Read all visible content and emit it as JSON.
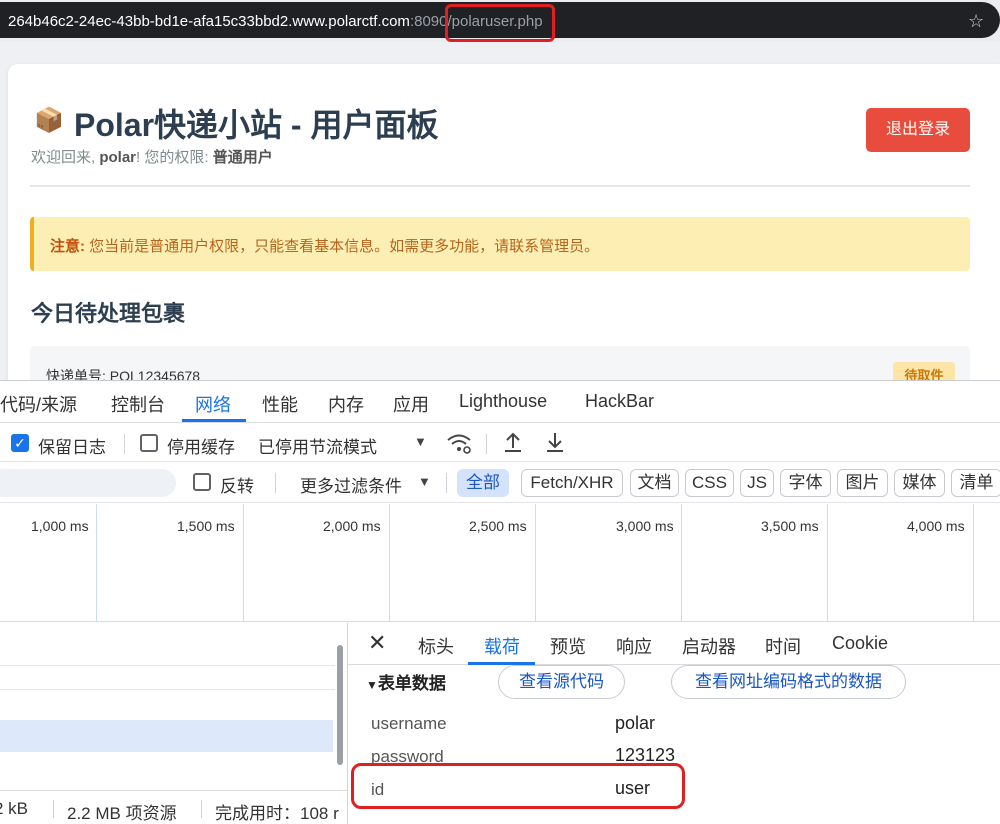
{
  "browser": {
    "url_host": "264b46c2-24ec-43bb-bd1e-afa15c33bbd2.www.polarctf.com",
    "url_port": ":8090",
    "url_path": "/polaruser.php",
    "bookmark_icon": "star-icon"
  },
  "page": {
    "icon": "📦",
    "title": "Polar快递小站 - 用户面板",
    "welcome_prefix": "欢迎回来,",
    "username": "polar",
    "welcome_mid": "! 您的权限:",
    "role": "普通用户",
    "logout_label": "退出登录",
    "notice_label": "注意:",
    "notice_text": "您当前是普通用户权限，只能查看基本信息。如需更多功能，请联系管理员。",
    "section_title": "今日待处理包裹",
    "package_label": "快递单号:",
    "package_no": "POL12345678",
    "package_status": "待取件"
  },
  "devtools": {
    "tabs": [
      "代码/来源",
      "控制台",
      "网络",
      "性能",
      "内存",
      "应用",
      "Lighthouse",
      "HackBar"
    ],
    "toolbar": {
      "preserve_log": "保留日志",
      "disable_cache": "停用缓存",
      "throttling": "已停用节流模式"
    },
    "filter": {
      "invert": "反转",
      "more_filters": "更多过滤条件",
      "types": [
        "全部",
        "Fetch/XHR",
        "文档",
        "CSS",
        "JS",
        "字体",
        "图片",
        "媒体",
        "清单"
      ]
    },
    "timeline_ticks": [
      "1,000 ms",
      "1,500 ms",
      "2,000 ms",
      "2,500 ms",
      "3,000 ms",
      "3,500 ms",
      "4,000 ms"
    ],
    "status": {
      "transferred": "2 kB",
      "resources": "2.2 MB 项资源",
      "finish": "完成用时：108 r"
    },
    "detail": {
      "tabs": [
        "标头",
        "载荷",
        "预览",
        "响应",
        "启动器",
        "时间",
        "Cookie"
      ],
      "form_data_title": "表单数据",
      "view_source": "查看源代码",
      "view_url_encoded": "查看网址编码格式的数据",
      "fields": [
        {
          "key": "username",
          "value": "polar"
        },
        {
          "key": "password",
          "value": "123123"
        },
        {
          "key": "id",
          "value": "user"
        }
      ]
    }
  }
}
